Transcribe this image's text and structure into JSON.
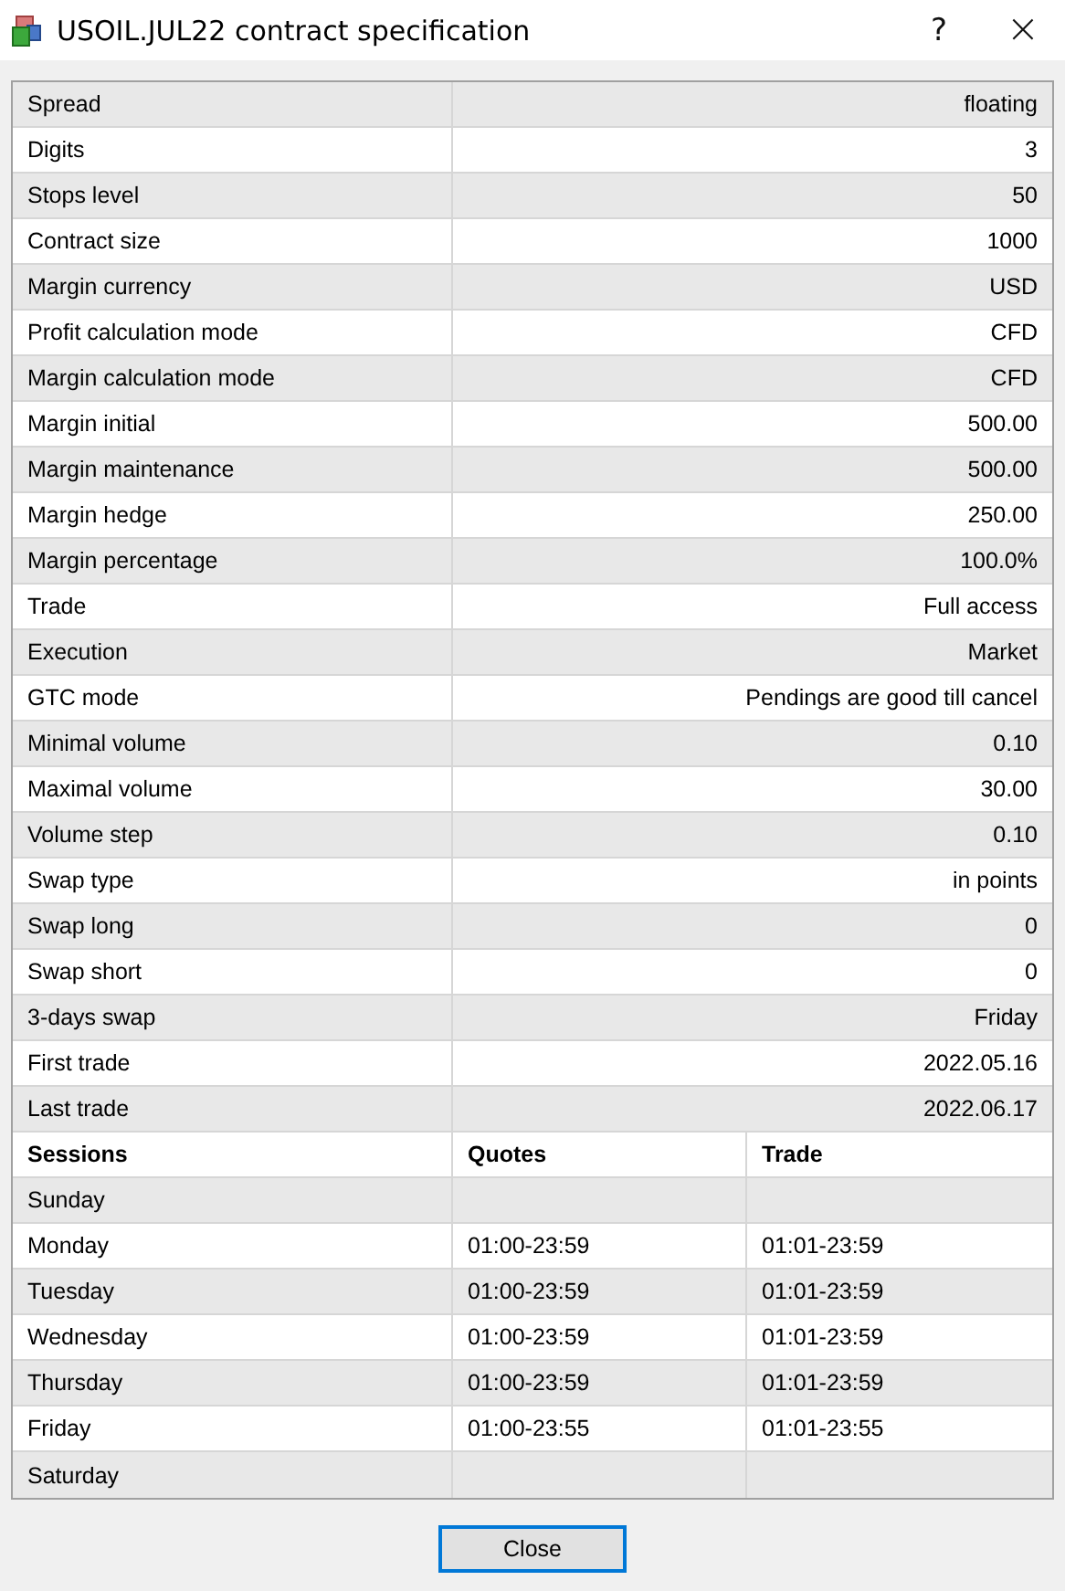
{
  "window": {
    "title": "USOIL.JUL22 contract specification",
    "help": "?",
    "close": "×"
  },
  "specs": [
    {
      "label": "Spread",
      "value": "floating"
    },
    {
      "label": "Digits",
      "value": "3"
    },
    {
      "label": "Stops level",
      "value": "50"
    },
    {
      "label": "Contract size",
      "value": "1000"
    },
    {
      "label": "Margin currency",
      "value": "USD"
    },
    {
      "label": "Profit calculation mode",
      "value": "CFD"
    },
    {
      "label": "Margin calculation mode",
      "value": "CFD"
    },
    {
      "label": "Margin initial",
      "value": "500.00"
    },
    {
      "label": "Margin maintenance",
      "value": "500.00"
    },
    {
      "label": "Margin hedge",
      "value": "250.00"
    },
    {
      "label": "Margin percentage",
      "value": "100.0%"
    },
    {
      "label": "Trade",
      "value": "Full access"
    },
    {
      "label": "Execution",
      "value": "Market"
    },
    {
      "label": "GTC mode",
      "value": "Pendings are good till cancel"
    },
    {
      "label": "Minimal volume",
      "value": "0.10"
    },
    {
      "label": "Maximal volume",
      "value": "30.00"
    },
    {
      "label": "Volume step",
      "value": "0.10"
    },
    {
      "label": "Swap type",
      "value": "in points"
    },
    {
      "label": "Swap long",
      "value": "0"
    },
    {
      "label": "Swap short",
      "value": "0"
    },
    {
      "label": "3-days swap",
      "value": "Friday"
    },
    {
      "label": "First trade",
      "value": "2022.05.16"
    },
    {
      "label": "Last trade",
      "value": "2022.06.17"
    }
  ],
  "sessions": {
    "columns": [
      "Sessions",
      "Quotes",
      "Trade"
    ],
    "rows": [
      {
        "day": "Sunday"
      },
      {
        "day": "Monday",
        "quotes": "01:00-23:59",
        "trade": "01:01-23:59"
      },
      {
        "day": "Tuesday",
        "quotes": "01:00-23:59",
        "trade": "01:01-23:59"
      },
      {
        "day": "Wednesday",
        "quotes": "01:00-23:59",
        "trade": "01:01-23:59"
      },
      {
        "day": "Thursday",
        "quotes": "01:00-23:59",
        "trade": "01:01-23:59"
      },
      {
        "day": "Friday",
        "quotes": "01:00-23:55",
        "trade": "01:01-23:55"
      },
      {
        "day": "Saturday"
      }
    ]
  },
  "buttons": [
    "Close"
  ]
}
